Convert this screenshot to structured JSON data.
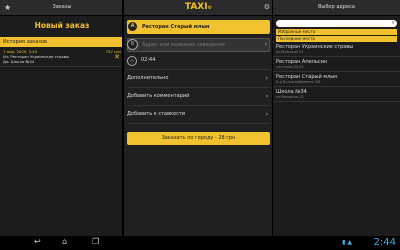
{
  "left": {
    "topbar_title": "Заказы",
    "new_order": "Новый заказ",
    "history_header": "История заказов",
    "history": [
      {
        "date": "7 мая, 2009, 2:40",
        "price": "747 грн",
        "line1": "Из: Ресторан Украинские стравы",
        "line2": "До: Школа №34"
      }
    ]
  },
  "mid": {
    "logo": "TAXI",
    "from": {
      "letter": "A",
      "value": "Ресторан Старый млын"
    },
    "to": {
      "letter": "B",
      "placeholder": "Адрес или название заведения"
    },
    "time": "02:44",
    "rows": [
      "Дополнительно",
      "Добавить комментарий",
      "Добавить к ставкости"
    ],
    "order_button": "Заказать по городу - 28 грн"
  },
  "right": {
    "topbar_title": "Выбор адреса",
    "tabs": [
      "Избранные места",
      "Последние места"
    ],
    "addresses": [
      {
        "name": "Ресторан Украинские стравы",
        "sub": "ул.Музыкой 11"
      },
      {
        "name": "Ресторан Апельсин",
        "sub": "ул.Отрок 22/71"
      },
      {
        "name": "Ресторан Старый млын",
        "sub": "Б-р Бульв.Шевченко 3/8"
      },
      {
        "name": "Школа №34",
        "sub": "ул.Малютан 12"
      }
    ]
  },
  "status": {
    "time": "2:44"
  }
}
